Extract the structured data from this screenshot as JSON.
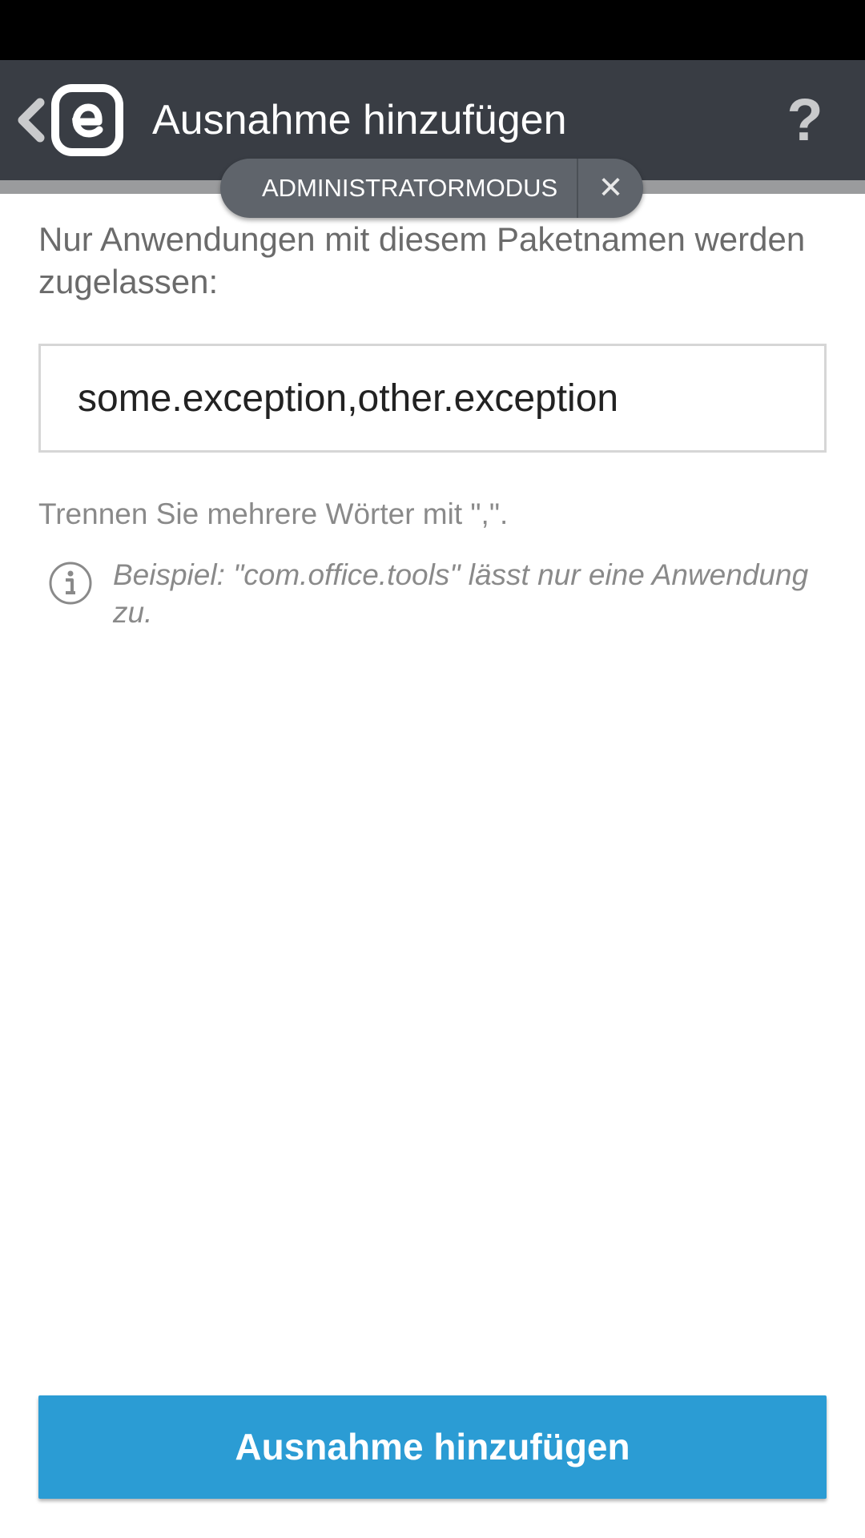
{
  "action_bar": {
    "title": "Ausnahme hinzufügen",
    "back_icon": "chevron-left-icon",
    "logo_icon": "eset-logo-icon",
    "help_label": "?"
  },
  "admin_mode": {
    "label": "ADMINISTRATORMODUS",
    "close_label": "✕"
  },
  "content": {
    "description": "Nur Anwendungen mit diesem Paketnamen werden zugelassen:",
    "package_input": {
      "value": "some.exception,other.exception",
      "placeholder": ""
    },
    "hint": "Trennen Sie mehrere Wörter mit \",\".",
    "example": "Beispiel: \"com.office.tools\" lässt nur eine Anwendung zu."
  },
  "footer": {
    "add_button_label": "Ausnahme hinzufügen"
  },
  "colors": {
    "action_bar": "#393d44",
    "status_bar": "#000000",
    "accent_button": "#2b9cd4",
    "admin_pill": "#5f646b",
    "text_secondary": "#8a8a8a"
  }
}
